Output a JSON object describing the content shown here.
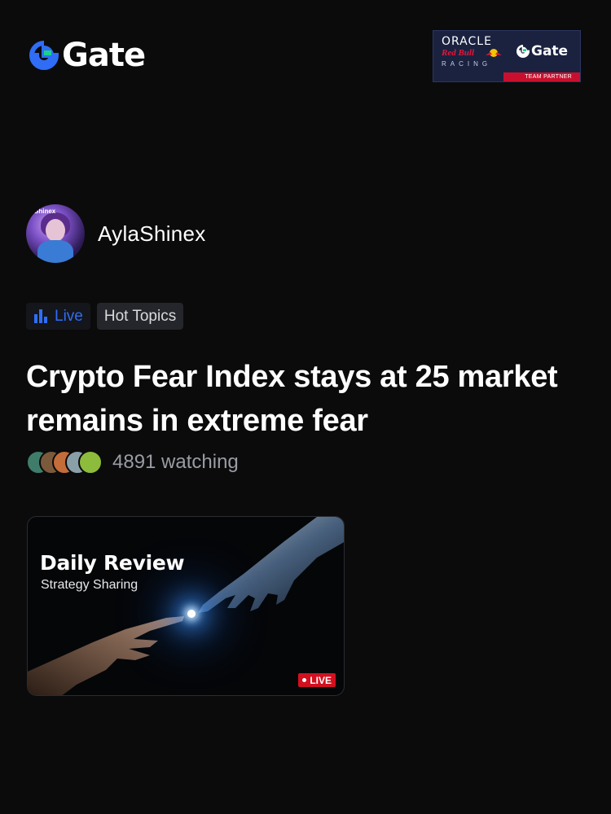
{
  "header": {
    "brand": "Gate",
    "partner": {
      "line1": "ORACLE",
      "line2": "Red Bull",
      "line3": "RACING",
      "gate": "Gate",
      "badge": "TEAM PARTNER"
    }
  },
  "author": {
    "avatar_tag": "Shinex",
    "name": "AylaShinex"
  },
  "tags": {
    "live": "Live",
    "topic": "Hot Topics"
  },
  "headline": "Crypto Fear Index stays at 25 market remains in extreme fear",
  "watchers": {
    "text": "4891 watching",
    "avatar_colors": [
      "#3f7d6a",
      "#7b5a3c",
      "#c46c3a",
      "#8aa0a8",
      "#8dbb3b"
    ]
  },
  "card": {
    "title": "Daily Review",
    "subtitle": "Strategy Sharing",
    "badge": "LIVE"
  },
  "colors": {
    "accent_blue": "#2f6df6",
    "live_red": "#d3101f",
    "background": "#0b0b0c"
  }
}
